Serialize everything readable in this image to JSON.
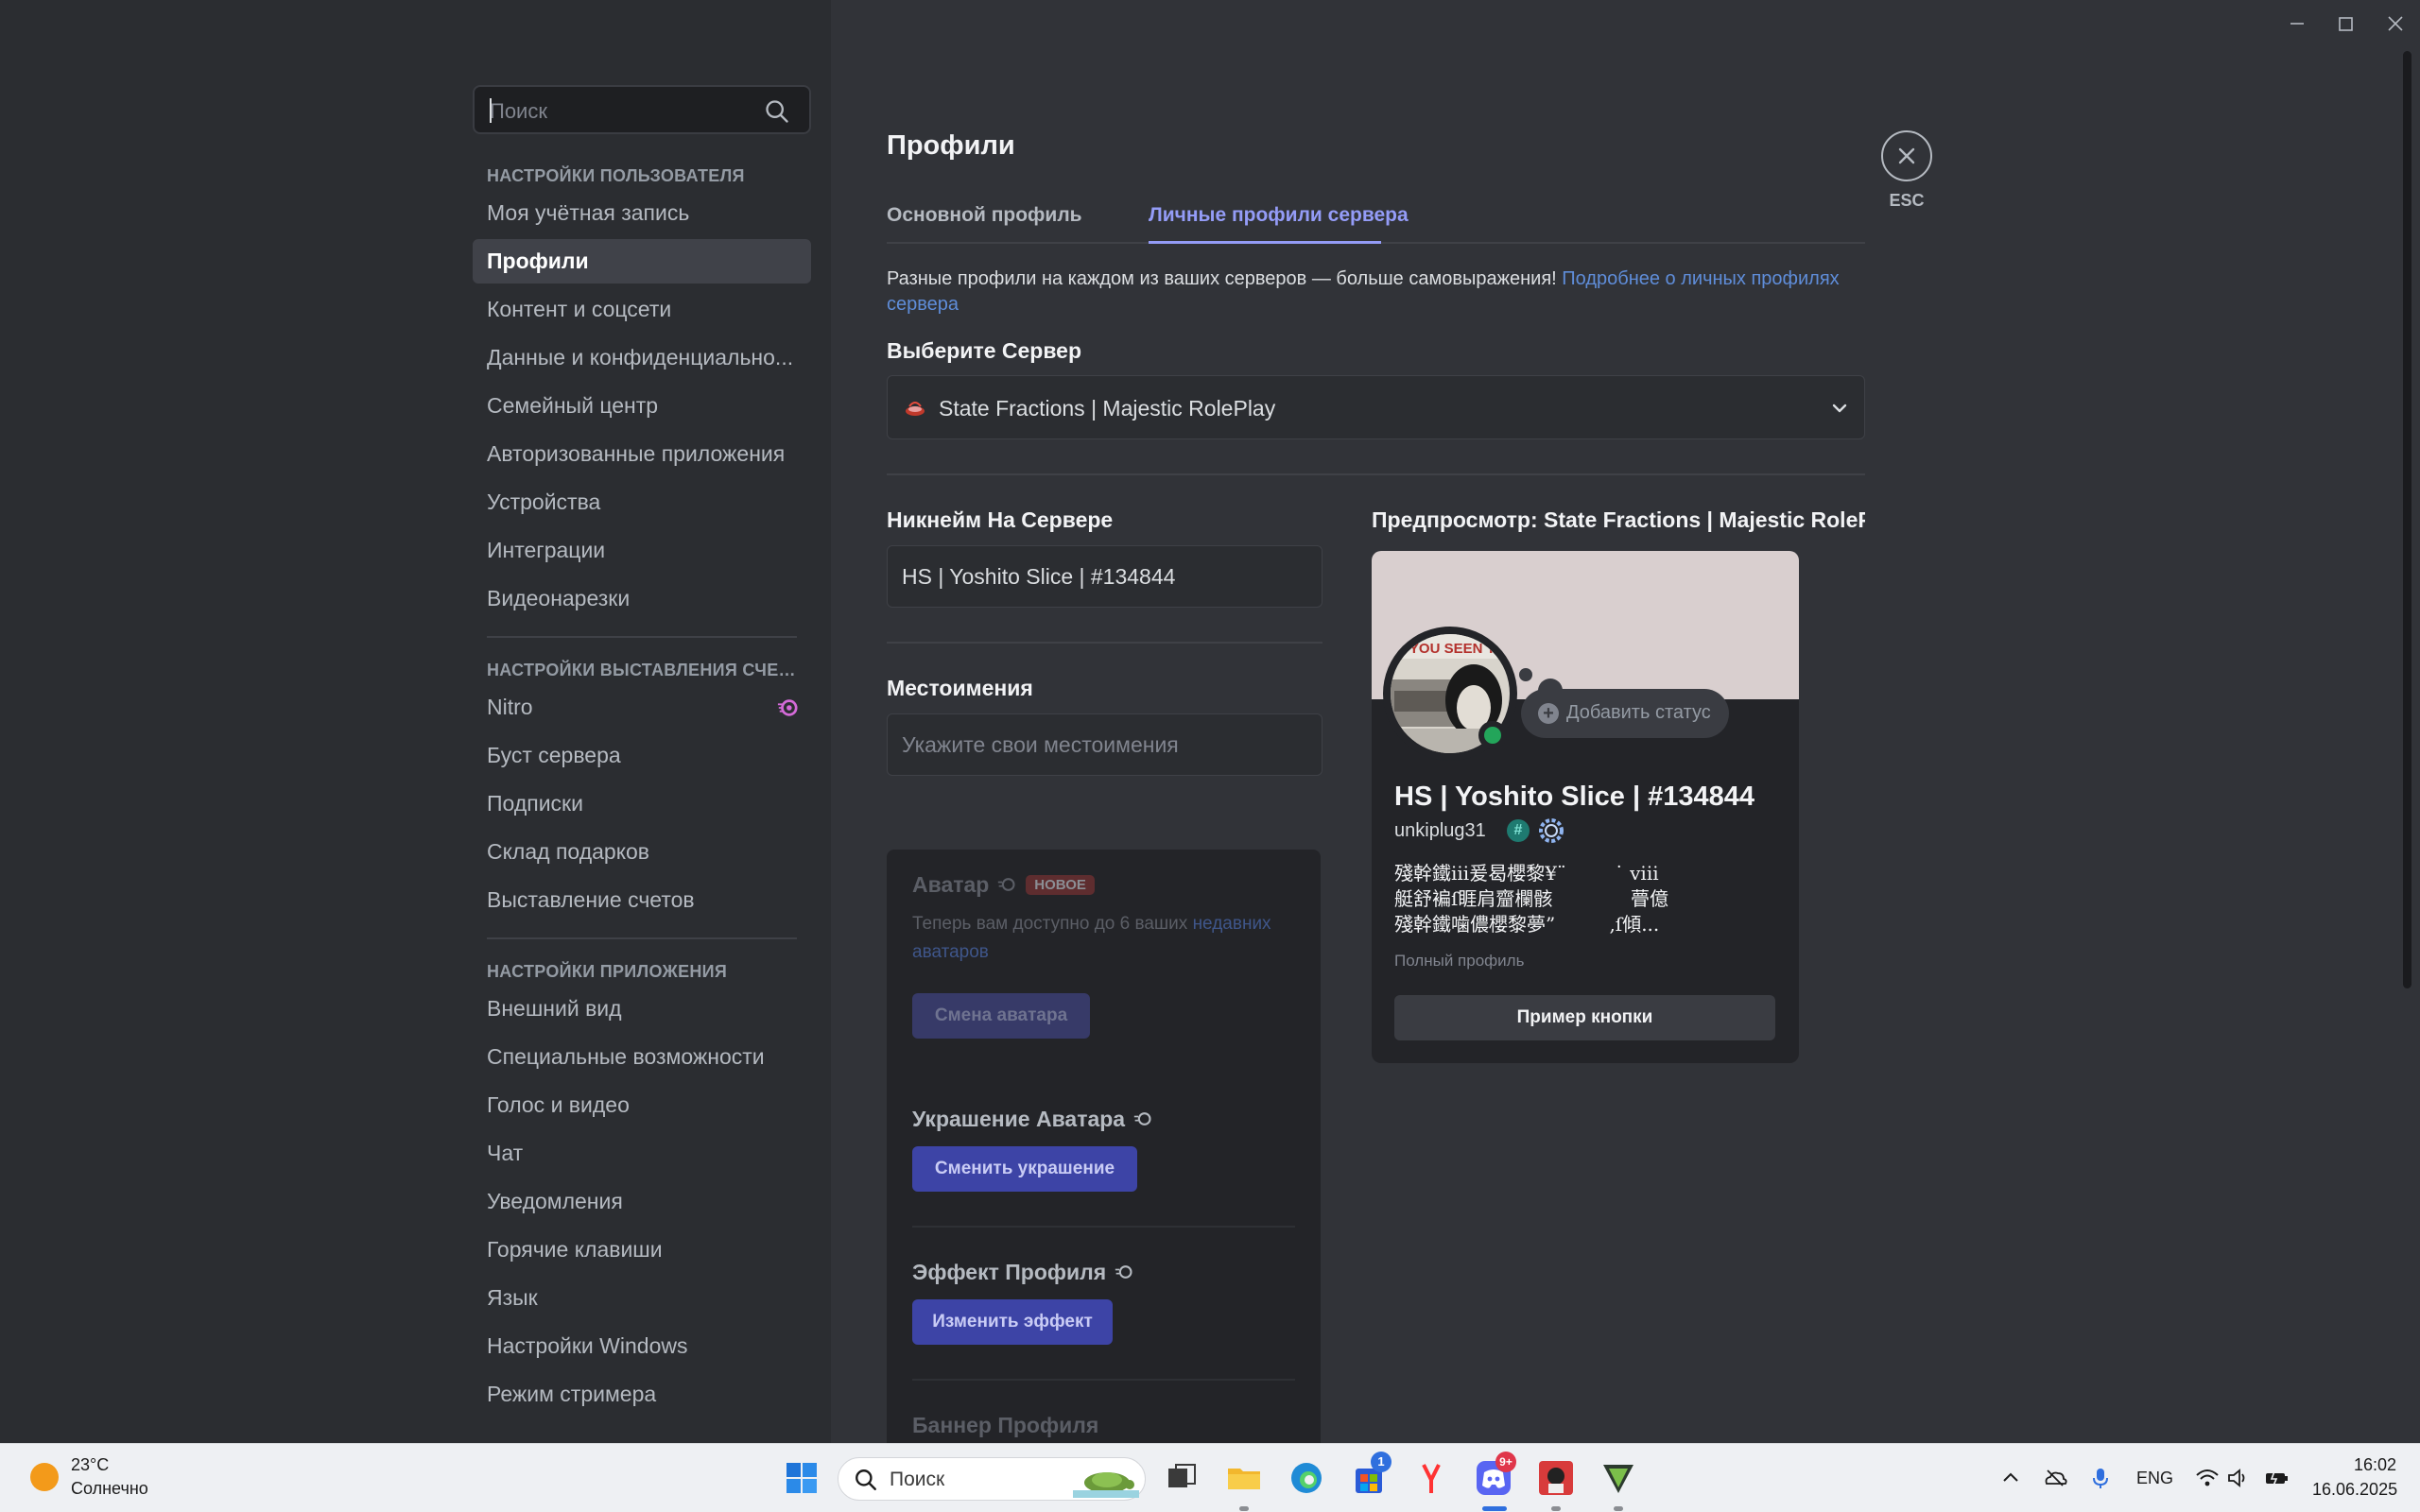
{
  "window": {
    "minimize_icon": "minimize-icon",
    "maximize_icon": "maximize-icon",
    "close_icon": "close-icon"
  },
  "sidebar": {
    "search_placeholder": "Поиск",
    "sections": [
      {
        "header": "НАСТРОЙКИ ПОЛЬЗОВАТЕЛЯ",
        "items": [
          "Моя учётная запись",
          "Профили",
          "Контент и соцсети",
          "Данные и конфиденциально...",
          "Семейный центр",
          "Авторизованные приложения",
          "Устройства",
          "Интеграции",
          "Видеонарезки"
        ]
      },
      {
        "header": "НАСТРОЙКИ ВЫСТАВЛЕНИЯ СЧЕТ...",
        "items": [
          "Nitro",
          "Буст сервера",
          "Подписки",
          "Склад подарков",
          "Выставление счетов"
        ]
      },
      {
        "header": "НАСТРОЙКИ ПРИЛОЖЕНИЯ",
        "items": [
          "Внешний вид",
          "Специальные возможности",
          "Голос и видео",
          "Чат",
          "Уведомления",
          "Горячие клавиши",
          "Язык",
          "Настройки Windows",
          "Режим стримера"
        ]
      }
    ],
    "active_item": "Профили"
  },
  "main": {
    "title": "Профили",
    "tabs": [
      {
        "label": "Основной профиль",
        "active": false
      },
      {
        "label": "Личные профили сервера",
        "active": true
      }
    ],
    "intro_text": "Разные профили на каждом из ваших серверов — больше самовыражения!",
    "intro_link": "Подробнее о личных профилях сервера",
    "server_label": "Выберите Сервер",
    "server_selected": "State Fractions | Majestic RolePlay",
    "nickname_label": "Никнейм На Сервере",
    "nickname_value": "HS | Yoshito Slice | #134844",
    "pronouns_label": "Местоимения",
    "pronouns_placeholder": "Укажите свои местоимения",
    "avatar": {
      "title": "Аватар",
      "badge": "НОВОЕ",
      "desc_prefix": "Теперь вам доступно до 6 ваших",
      "desc_link": "недавних аватаров",
      "button": "Смена аватара"
    },
    "decoration": {
      "title": "Украшение Аватара",
      "button": "Сменить украшение"
    },
    "effect": {
      "title": "Эффект Профиля",
      "button": "Изменить эффект"
    },
    "banner": {
      "title": "Баннер Профиля"
    },
    "preview": {
      "label": "Предпросмотр: State Fractions | Majestic RolePl",
      "add_status": "Добавить статус",
      "display_name": "HS | Yoshito Slice | #134844",
      "username": "unkiplug31",
      "bio_lines": [
        "殘幹鐵iii爰曷櫻黎¥¨        ˙ viii",
        "艇舒褊ſ睚肩齏欄骸             瞢億",
        "殘幹鐵噛儂櫻黎夢”         ,ſ傾..."
      ],
      "full_profile": "Полный профиль",
      "example_button": "Пример кнопки"
    },
    "close_label": "ESC"
  },
  "taskbar": {
    "weather_temp": "23°C",
    "weather_desc": "Солнечно",
    "search_placeholder": "Поиск",
    "store_badge": "1",
    "discord_badge": "9+",
    "lang": "ENG",
    "time": "16:02",
    "date": "16.06.2025"
  },
  "colors": {
    "accent": "#949cf7",
    "online": "#23a55a",
    "button": "#3d44a6"
  }
}
